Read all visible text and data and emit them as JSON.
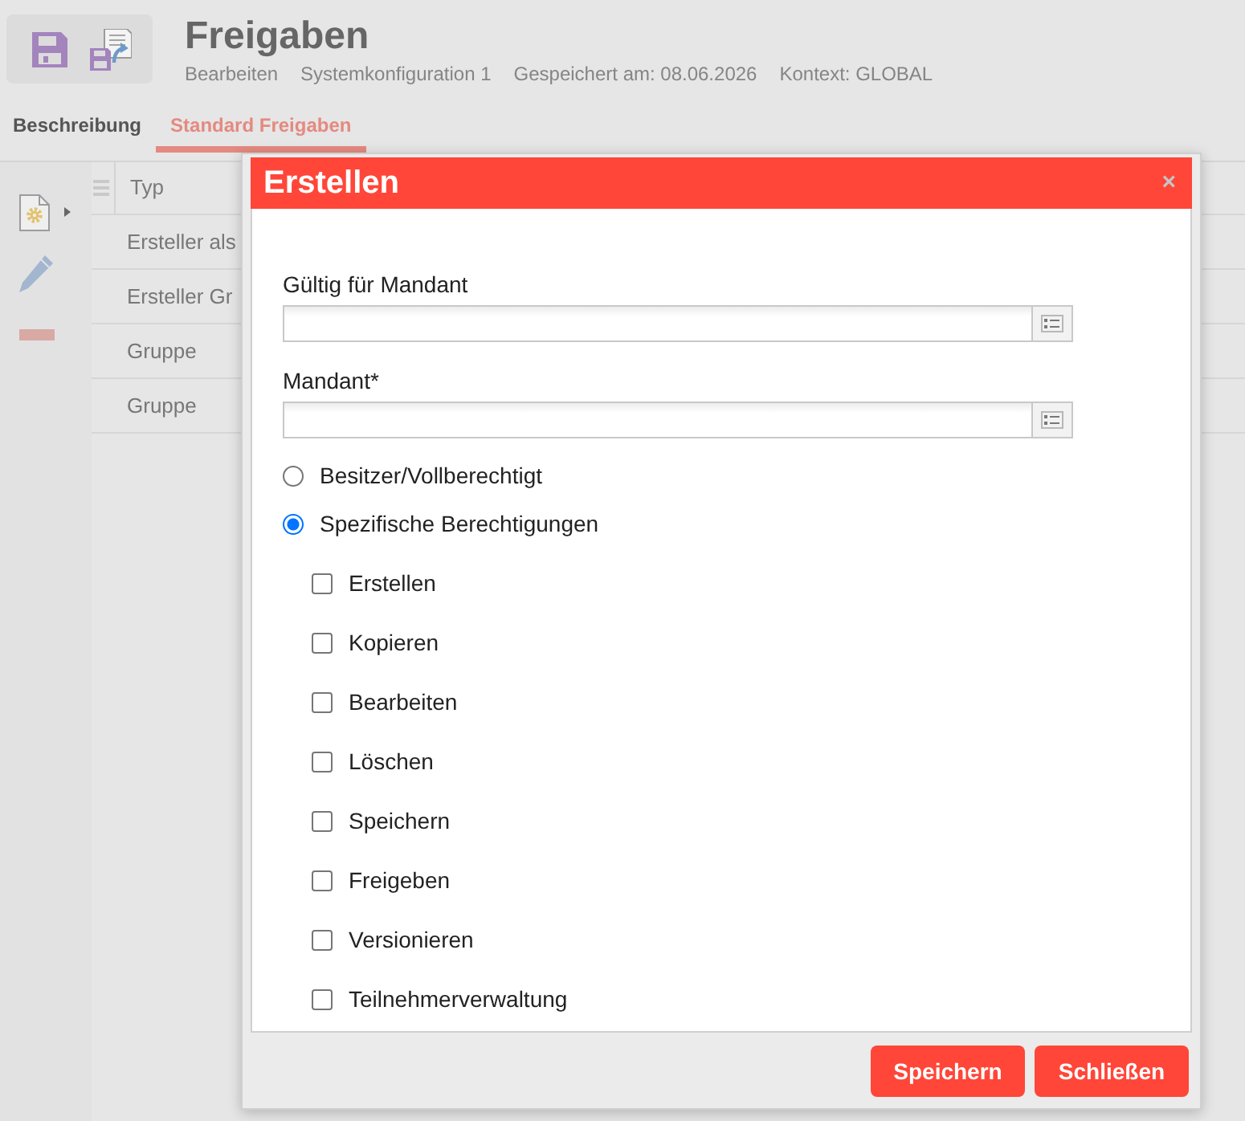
{
  "toolbar": {
    "tools": [
      {
        "kind": "save"
      },
      {
        "kind": "save-as"
      }
    ]
  },
  "header": {
    "title": "Freigaben",
    "meta": [
      "Bearbeiten",
      "Systemkonfiguration 1",
      "Gespeichert am: 08.06.2026",
      "Kontext: GLOBAL"
    ]
  },
  "tabs": [
    {
      "label": "Beschreibung",
      "selected": false
    },
    {
      "label": "Standard Freigaben",
      "selected": true
    }
  ],
  "sidebar": {
    "tools": [
      {
        "kind": "new",
        "menu": true
      },
      {
        "kind": "edit",
        "menu": false
      },
      {
        "kind": "remove",
        "menu": false
      }
    ]
  },
  "table": {
    "columns": [
      "Typ"
    ],
    "rows": [
      [
        "Ersteller als"
      ],
      [
        "Ersteller Gr"
      ],
      [
        "Gruppe"
      ],
      [
        "Gruppe"
      ]
    ]
  },
  "dialog": {
    "title": "Erstellen",
    "close": "×",
    "fields": [
      {
        "label": "Gültig für Mandant"
      },
      {
        "label": "Mandant*"
      }
    ],
    "options": [
      {
        "label": "Besitzer/Vollberechtigt",
        "selected": false
      },
      {
        "label": "Spezifische Berechtigungen",
        "selected": true
      }
    ],
    "permissions": [
      {
        "label": "Erstellen",
        "checked": false
      },
      {
        "label": "Kopieren",
        "checked": false
      },
      {
        "label": "Bearbeiten",
        "checked": false
      },
      {
        "label": "Löschen",
        "checked": false
      },
      {
        "label": "Speichern",
        "checked": false
      },
      {
        "label": "Freigeben",
        "checked": false
      },
      {
        "label": "Versionieren",
        "checked": false
      },
      {
        "label": "Teilnehmerverwaltung",
        "checked": false
      }
    ],
    "buttons": [
      "Speichern",
      "Schließen"
    ]
  }
}
